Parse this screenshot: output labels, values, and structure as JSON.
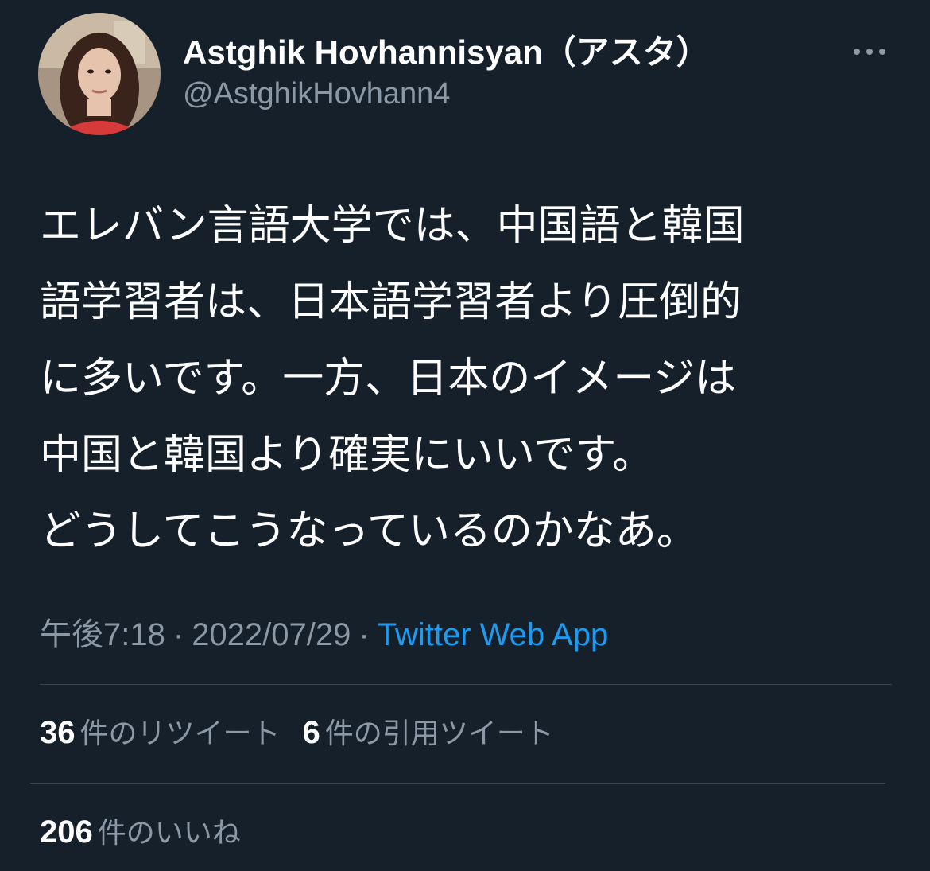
{
  "author": {
    "display_name": "Astghik Hovhannisyan（アスタ）",
    "handle": "@AstghikHovhann4"
  },
  "menu": {
    "more_icon": "more-horizontal-icon"
  },
  "tweet": {
    "text": "エレバン言語大学では、中国語と韓国\n語学習者は、日本語学習者より圧倒的\nに多いです。一方、日本のイメージは\n中国と韓国より確実にいいです。\nどうしてこうなっているのかなあ。",
    "time": "午後7:18",
    "separator": "·",
    "date": "2022/07/29",
    "source": "Twitter Web App"
  },
  "stats": {
    "retweets_count": "36",
    "retweets_label": "件のリツイート",
    "quotes_count": "6",
    "quotes_label": "件の引用ツイート",
    "likes_count": "206",
    "likes_label": "件のいいね"
  },
  "colors": {
    "background": "#15202b",
    "text_primary": "#ffffff",
    "text_secondary": "#8b98a5",
    "link": "#1d9bf0",
    "divider": "#38444d"
  }
}
